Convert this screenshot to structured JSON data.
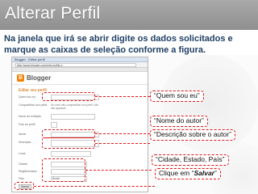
{
  "slide": {
    "title": "Alterar Perfil",
    "instruction": "Na janela que irá se abrir digite os dados solicitados e marque as caixas de seleção conforme a figura."
  },
  "screenshot": {
    "window_title": "Blogger - Editar perfil",
    "url": "http://www.blogger.com/edit-profile.g",
    "app_name": "Blogger",
    "heading": "Editar seu perfil",
    "fields": [
      {
        "label": "Quem sou eu",
        "value": "",
        "kind": "text"
      },
      {
        "label": "Compartilhar seu perfil",
        "value": "Se você não compartilhar seu perfil, não vão aparecer",
        "kind": "note"
      },
      {
        "label": "Nome de exibição",
        "value": "",
        "kind": "text"
      },
      {
        "label": "Foto do perfil",
        "value": "",
        "kind": "photo"
      },
      {
        "label": "Nome",
        "value": "",
        "kind": "text"
      },
      {
        "label": "Descrição",
        "value": "",
        "kind": "text"
      },
      {
        "label": "Local",
        "value": "",
        "kind": "text"
      },
      {
        "label": "Cidade",
        "value": "",
        "kind": "text"
      },
      {
        "label": "Região/estado",
        "value": "",
        "kind": "text"
      },
      {
        "label": "País",
        "value": "Brasil",
        "kind": "text"
      }
    ],
    "save_label": "Salvar"
  },
  "callouts": {
    "quem_sou_eu": "“Quem sou eu”",
    "nome_autor": "“Nome do autor”",
    "descricao": "“Descrição sobre o autor”",
    "cidade": "“Cidade, Estado, País”",
    "salvar_prefix": "Clique em “",
    "salvar_word": "Salvar",
    "salvar_suffix": "”"
  },
  "colors": {
    "title_bar": "#999999",
    "title_text": "#ffffff",
    "instruction_text": "#1f3f63",
    "highlight": "#e0161a",
    "blogger_orange": "#f57d00"
  }
}
